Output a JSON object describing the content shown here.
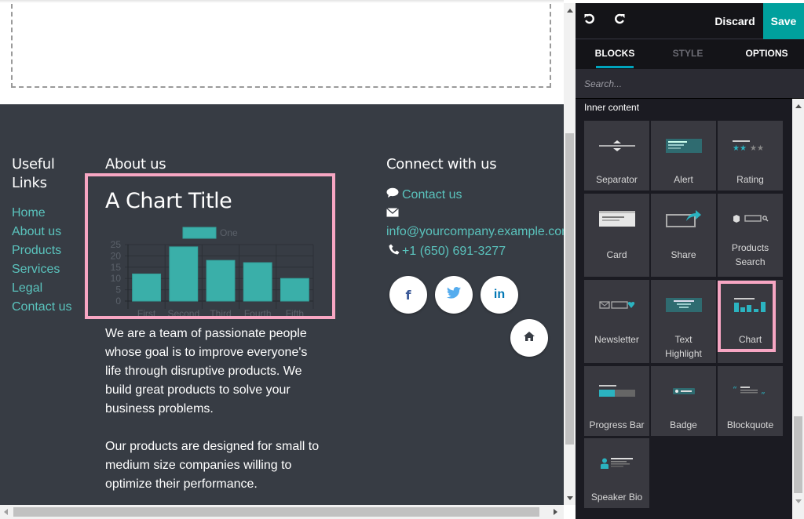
{
  "footer": {
    "useful_links": {
      "title_line1": "Useful",
      "title_line2": "Links",
      "items": [
        "Home",
        "About us",
        "Products",
        "Services",
        "Legal",
        "Contact us"
      ]
    },
    "about": {
      "title": "About us",
      "paragraph1": "We are a team of passionate people whose goal is to improve everyone's life through disruptive products. We build great products to solve your business problems.",
      "paragraph2": "Our products are designed for small to medium size companies willing to optimize their performance."
    },
    "connect": {
      "title": "Connect with us",
      "contact_label": "Contact us",
      "email": "info@yourcompany.example.com",
      "phone": "+1 (650) 691-3277",
      "icons": {
        "contact": "comment-icon",
        "email": "envelope-icon",
        "phone": "phone-icon"
      },
      "social": [
        {
          "name": "facebook",
          "glyph": "f",
          "color": "#3b5998"
        },
        {
          "name": "twitter",
          "glyph": "🐦",
          "color": "#55acee"
        },
        {
          "name": "linkedin",
          "glyph": "in",
          "color": "#0077b5"
        }
      ],
      "home_glyph": "⌂"
    }
  },
  "chart_data": {
    "type": "bar",
    "title": "A Chart Title",
    "categories": [
      "First",
      "Second",
      "Third",
      "Fourth",
      "Fifth"
    ],
    "series": [
      {
        "name": "One",
        "values": [
          12,
          24,
          18,
          17,
          10
        ],
        "color": "#3aafa9"
      }
    ],
    "ylim": [
      0,
      25
    ],
    "yticks": [
      0,
      5,
      10,
      15,
      20,
      25
    ],
    "grid": true,
    "legend": "top-center",
    "xlabel": "",
    "ylabel": ""
  },
  "editor": {
    "undo_icon": "undo-icon",
    "redo_icon": "redo-icon",
    "discard_label": "Discard",
    "save_label": "Save",
    "tabs": [
      "BLOCKS",
      "STYLE",
      "OPTIONS"
    ],
    "active_tab": "BLOCKS",
    "search_placeholder": "Search...",
    "section_label": "Inner content",
    "blocks": [
      {
        "label": "Separator",
        "icon": "separator-icon"
      },
      {
        "label": "Alert",
        "icon": "alert-icon"
      },
      {
        "label": "Rating",
        "icon": "rating-icon"
      },
      {
        "label": "Card",
        "icon": "card-icon"
      },
      {
        "label": "Share",
        "icon": "share-icon"
      },
      {
        "label": "Products Search",
        "icon": "products-search-icon"
      },
      {
        "label": "Newsletter",
        "icon": "newsletter-icon"
      },
      {
        "label": "Text Highlight",
        "icon": "text-highlight-icon"
      },
      {
        "label": "Chart",
        "icon": "chart-icon",
        "highlighted": true
      },
      {
        "label": "Progress Bar",
        "icon": "progress-bar-icon"
      },
      {
        "label": "Badge",
        "icon": "badge-icon"
      },
      {
        "label": "Blockquote",
        "icon": "blockquote-icon"
      },
      {
        "label": "Speaker Bio",
        "icon": "speaker-bio-icon"
      }
    ]
  },
  "colors": {
    "accent": "#00a09d",
    "link": "#5ac3bd",
    "footer_bg": "#373c44",
    "highlight": "#f7a6c3"
  }
}
